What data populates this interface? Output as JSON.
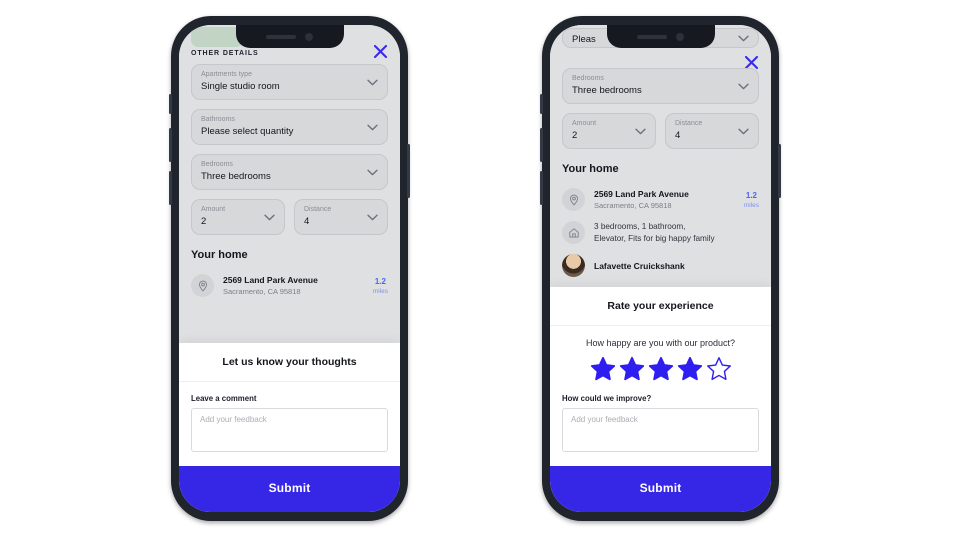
{
  "colors": {
    "accent": "#3626e6",
    "star_filled": "#2e1ff0",
    "link_blue": "#4a63f0",
    "screen_bg": "#dfe0e2",
    "card_bg": "#ffffff",
    "frame": "#20242c",
    "green_chip": "#c2d4c3"
  },
  "left_phone": {
    "sheet": {
      "title": "OTHER DETAILS",
      "close_icon": "close-x-icon"
    },
    "fields": [
      {
        "label": "Apartments type",
        "value": "Single studio room",
        "icon": "chevron-down-icon"
      },
      {
        "label": "Bathrooms",
        "value": "Please select quantity",
        "icon": "chevron-down-icon"
      },
      {
        "label": "Bedrooms",
        "value": "Three bedrooms",
        "icon": "chevron-down-icon"
      }
    ],
    "fields_row": [
      {
        "label": "Amount",
        "value": "2",
        "icon": "chevron-down-icon"
      },
      {
        "label": "Distance",
        "value": "4",
        "icon": "chevron-down-icon"
      }
    ],
    "your_home": {
      "section_title": "Your home",
      "address": {
        "icon": "map-pin-icon",
        "line1": "2569 Land Park Avenue",
        "line2": "Sacramento, CA 95818",
        "meta_value": "1.2",
        "meta_unit": "miles"
      }
    },
    "card": {
      "heading": "Let us know your thoughts",
      "comment_label": "Leave a comment",
      "comment_placeholder": "Add your feedback"
    },
    "submit_label": "Submit"
  },
  "right_phone": {
    "clipped_field": {
      "value": "Pleas",
      "icon": "chevron-down-icon"
    },
    "sheet": {
      "close_icon": "close-x-icon"
    },
    "fields": [
      {
        "label": "Bedrooms",
        "value": "Three bedrooms",
        "icon": "chevron-down-icon"
      }
    ],
    "fields_row": [
      {
        "label": "Amount",
        "value": "2",
        "icon": "chevron-down-icon"
      },
      {
        "label": "Distance",
        "value": "4",
        "icon": "chevron-down-icon"
      }
    ],
    "your_home": {
      "section_title": "Your home",
      "address": {
        "icon": "map-pin-icon",
        "line1": "2569 Land Park Avenue",
        "line2": "Sacramento, CA 95818",
        "meta_value": "1.2",
        "meta_unit": "miles"
      },
      "details": {
        "icon": "home-icon",
        "line1": "3 bedrooms, 1 bathroom,",
        "line2": "Elevator, Fits for big happy family"
      },
      "person": {
        "icon": "avatar",
        "name": "Lafavette Cruickshank"
      }
    },
    "card": {
      "heading": "Rate your experience",
      "question": "How happy are you with our product?",
      "rating": 4,
      "rating_max": 5,
      "improve_label": "How could we improve?",
      "improve_placeholder": "Add your feedback"
    },
    "submit_label": "Submit"
  }
}
